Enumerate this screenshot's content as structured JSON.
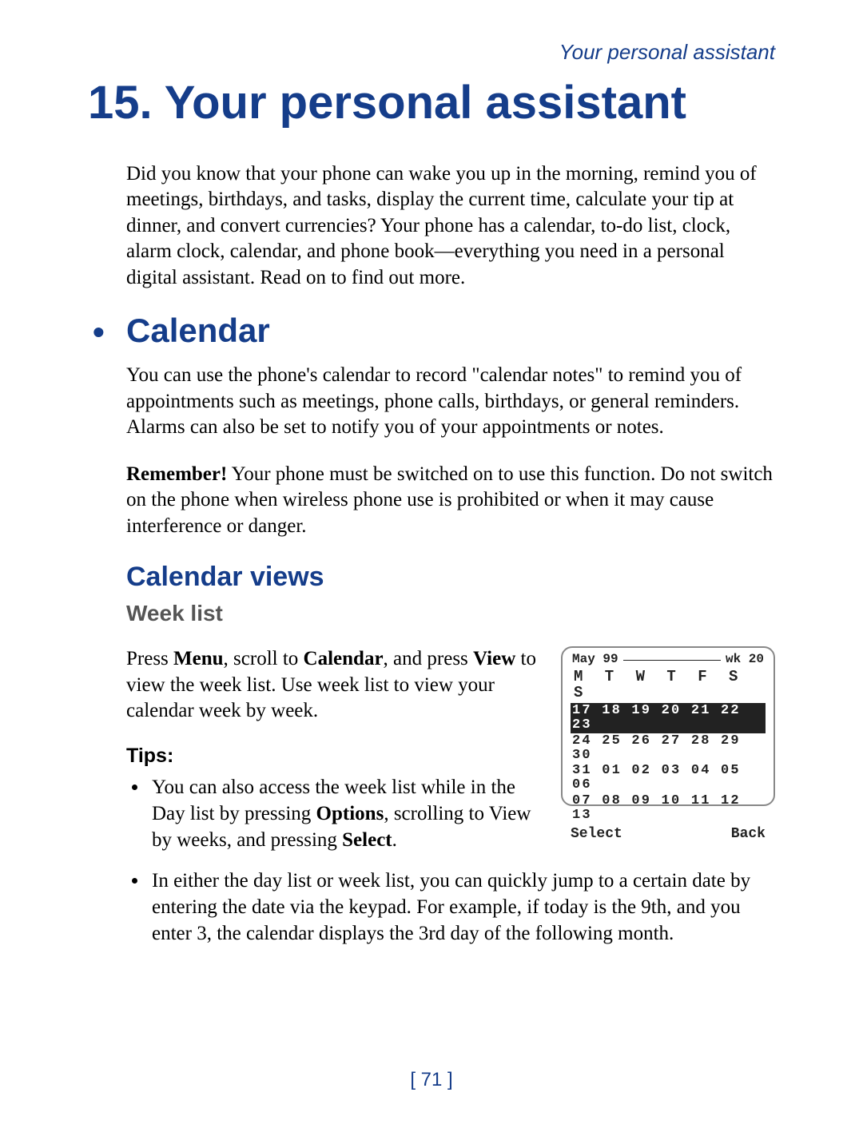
{
  "header": {
    "running_title": "Your personal assistant"
  },
  "chapter": {
    "number": "15.",
    "title": "Your personal assistant"
  },
  "intro_paragraph": "Did you know that your phone can wake you up in the morning, remind you of meetings, birthdays, and tasks, display the current time, calculate your tip at dinner, and convert currencies? Your phone has a calendar, to-do list, clock, alarm clock, calendar, and phone book—everything you need in a personal digital assistant. Read on to find out more.",
  "calendar": {
    "heading": "Calendar",
    "paragraph": "You can use the phone's calendar to record \"calendar notes\" to remind you of appointments such as meetings, phone calls, birthdays, or general reminders. Alarms can also be set to notify you of your appointments or notes.",
    "remember_label": "Remember!",
    "remember_text": "  Your phone must be switched on to use this function. Do not switch on the phone when wireless phone use is prohibited or when it may cause interference or danger.",
    "views_heading": "Calendar views",
    "week_heading": "Week list",
    "week_text_1a": "Press ",
    "week_text_menu": "Menu",
    "week_text_1b": ", scroll to ",
    "week_text_cal": "Calendar",
    "week_text_1c": ", and press ",
    "week_text_view": "View",
    "week_text_1d": " to view the week list. Use week list to view your calendar week by week.",
    "tips_label": "Tips:",
    "tips": [
      {
        "pre": "You can also access the week list while in the Day list by pressing ",
        "b1": "Options",
        "mid": ", scrolling to View by weeks, and pressing ",
        "b2": "Select",
        "post": "."
      },
      {
        "pre": "In either the day list or week list, you can quickly jump to a certain date by entering the date via the keypad. For example, if today is the 9th, and you enter 3, the calendar displays the 3rd day of the following month.",
        "b1": "",
        "mid": "",
        "b2": "",
        "post": ""
      }
    ]
  },
  "phone_screen": {
    "month": "May 99",
    "week_label": "wk 20",
    "day_letters": "M T W T F S S",
    "rows": [
      "17 18 19 20 21 22 23",
      "24 25 26 27 28 29 30",
      "31 01 02 03 04 05 06",
      "07 08 09 10 11 12 13"
    ],
    "left_softkey": "Select",
    "right_softkey": "Back"
  },
  "page_number": "[ 71 ]"
}
